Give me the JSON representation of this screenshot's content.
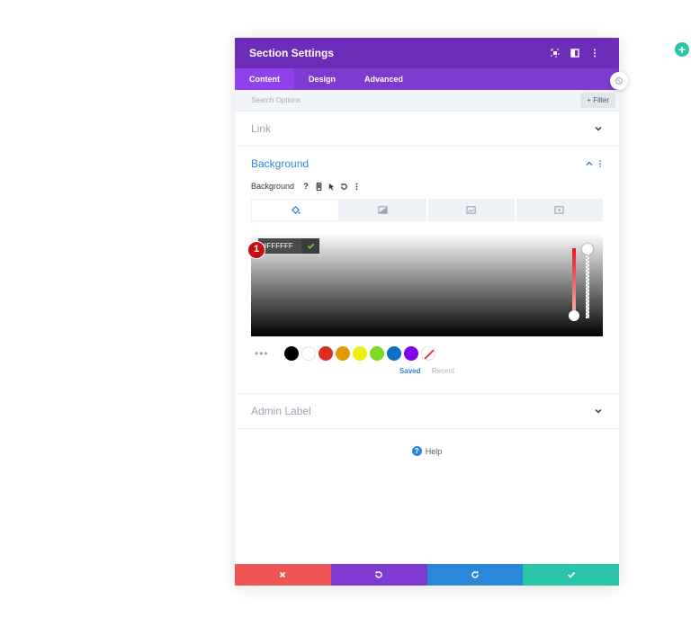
{
  "header": {
    "title": "Section Settings"
  },
  "tabs": [
    {
      "label": "Content",
      "active": true
    },
    {
      "label": "Design",
      "active": false
    },
    {
      "label": "Advanced",
      "active": false
    }
  ],
  "search": {
    "placeholder": "Search Options",
    "filter_label": "+ Filter"
  },
  "sections": {
    "link": {
      "title": "Link"
    },
    "background": {
      "title": "Background",
      "option_label": "Background",
      "help_glyph": "?",
      "hex_value": "#FFFFFF",
      "badge_number": "1",
      "swatches": [
        "#000000",
        "#ffffff",
        "#e02b20",
        "#e09900",
        "#edf000",
        "#7cda24",
        "#0c71c3",
        "#8300e9"
      ],
      "swatch_tabs": {
        "saved": "Saved",
        "recent": "Recent"
      }
    },
    "admin_label": {
      "title": "Admin Label"
    }
  },
  "help": {
    "label": "Help"
  },
  "colors": {
    "header": "#6c2eb9",
    "tab_bar": "#7e3bd0",
    "active_tab": "#8f42ec",
    "accent_blue": "#2b87da",
    "cancel": "#ef5555",
    "undo": "#7e3bd0",
    "redo": "#2b87da",
    "save": "#29c4a9",
    "fab": "#29c4a9"
  }
}
